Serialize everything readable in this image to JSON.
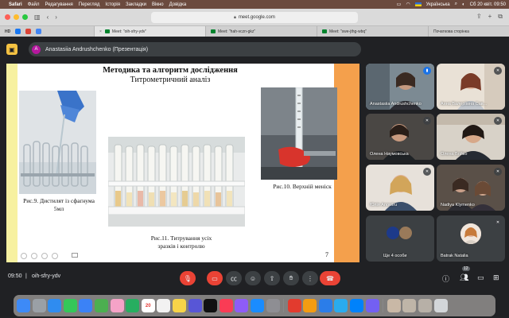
{
  "menubar": {
    "app": "Safari",
    "items": [
      "Файл",
      "Редагування",
      "Перегляд",
      "Історія",
      "Закладки",
      "Вікно",
      "Довідка"
    ],
    "keyboard": "Українська",
    "datetime": "Сб 20 квіт.  09:50"
  },
  "browser": {
    "url": "meet.google.com",
    "favorites": [
      "HD"
    ],
    "tabs": [
      {
        "label": "Meet: \"oih-sfry-ydv\"",
        "active": true
      },
      {
        "label": "Meet: \"hah-vczn-gkz\"",
        "active": false
      },
      {
        "label": "Meet: \"swe-jthg-wbq\"",
        "active": false
      },
      {
        "label": "Початкова сторінка",
        "active": false
      }
    ]
  },
  "meet": {
    "presenter_initial": "A",
    "presenter_label": "Anastasiia Andrushchenko (Презентація)",
    "time": "09:50",
    "meeting_code": "oih-sfry-ydv",
    "participants_badge": "12",
    "more_label": "Ще 4 особи"
  },
  "slide": {
    "title": "Методика та алгоритм дослідження",
    "subtitle": "Титрометричний аналіз",
    "captions": {
      "fig9_line1": "Рис.9. Дистилят із сфаґнума",
      "fig9_line2": "5мл",
      "fig10": "Рис.10.   Верхній меніск",
      "fig11_line1": "Рис.11. Титрування усіх",
      "fig11_line2": "зразків і контролю"
    },
    "page_number": "7"
  },
  "participants": [
    {
      "name": "Anastasiia Andrushchenko",
      "speaking": true
    },
    {
      "name": "Анна Валеріївна Сав..."
    },
    {
      "name": "Олена Наумовська"
    },
    {
      "name": "Олена Бойко"
    },
    {
      "name": "Юлія Anowiru"
    },
    {
      "name": "Nadiya Klymenko"
    },
    {
      "name": "Batrak Natalia"
    }
  ],
  "dock": {
    "calendar_day": "20"
  }
}
